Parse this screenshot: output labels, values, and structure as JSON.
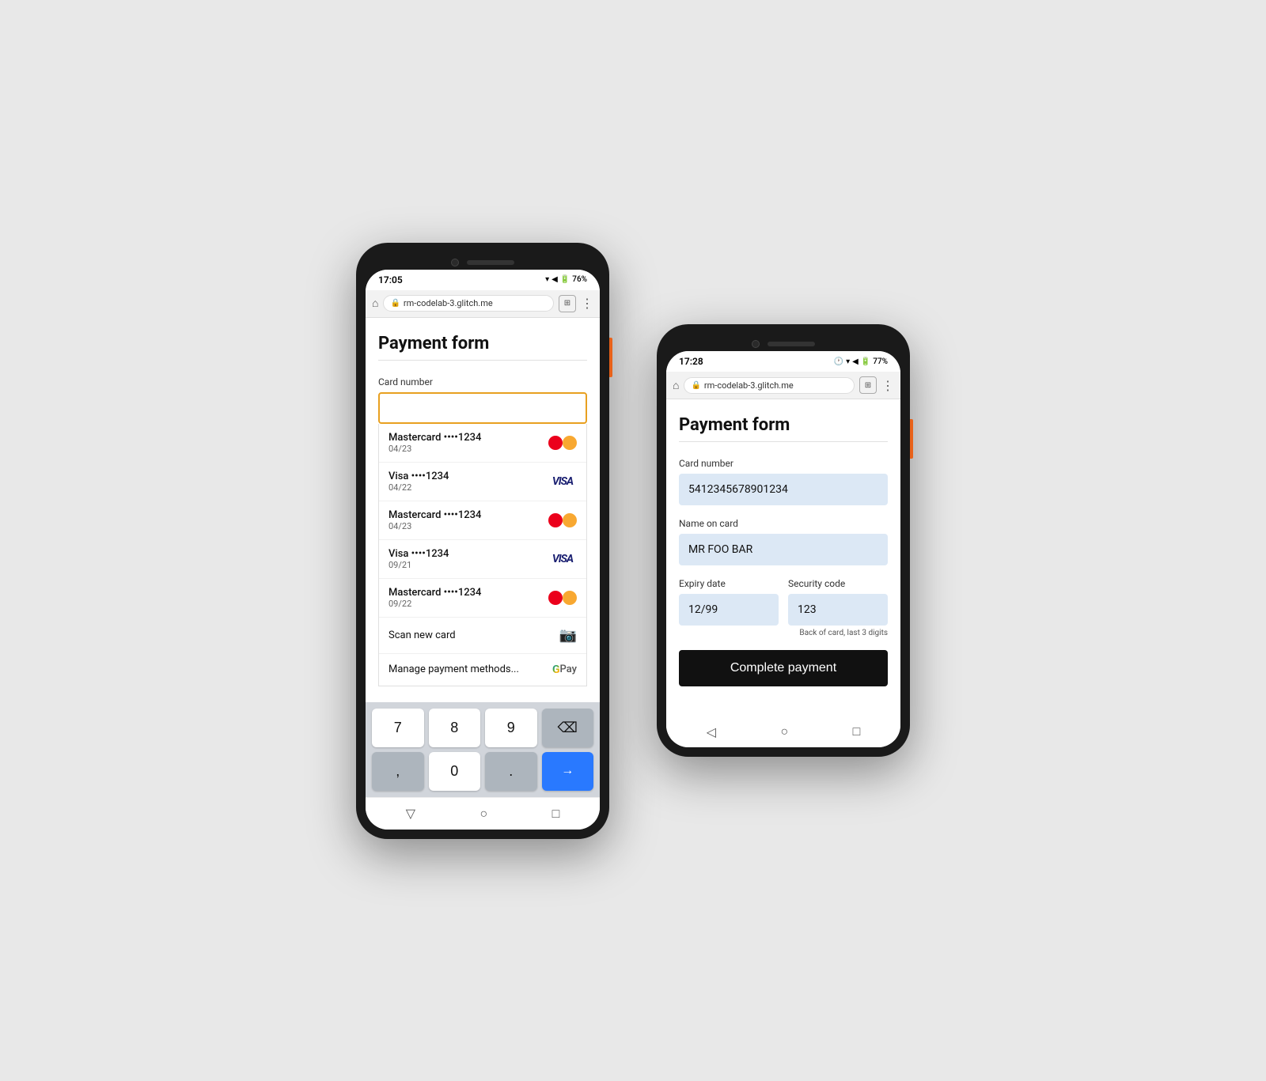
{
  "left_phone": {
    "status_bar": {
      "time": "17:05",
      "signal": "▼◀",
      "battery": "76%"
    },
    "browser": {
      "url": "rm-codelab-3.glitch.me"
    },
    "page": {
      "title": "Payment form",
      "card_number_label": "Card number",
      "card_input_placeholder": ""
    },
    "saved_cards": [
      {
        "name": "Mastercard ••••1234",
        "expiry": "04/23",
        "type": "mastercard"
      },
      {
        "name": "Visa ••••1234",
        "expiry": "04/22",
        "type": "visa"
      },
      {
        "name": "Mastercard ••••1234",
        "expiry": "04/23",
        "type": "mastercard"
      },
      {
        "name": "Visa ••••1234",
        "expiry": "09/21",
        "type": "visa"
      },
      {
        "name": "Mastercard ••••1234",
        "expiry": "09/22",
        "type": "mastercard"
      }
    ],
    "scan_card_label": "Scan new card",
    "manage_label": "Manage payment methods...",
    "keyboard": {
      "keys": [
        "7",
        "8",
        "9",
        "←",
        ",",
        "0",
        ".",
        "→"
      ]
    }
  },
  "right_phone": {
    "status_bar": {
      "time": "17:28",
      "battery": "77%"
    },
    "browser": {
      "url": "rm-codelab-3.glitch.me"
    },
    "page": {
      "title": "Payment form",
      "card_number_label": "Card number",
      "card_number_value": "5412345678901234",
      "name_label": "Name on card",
      "name_value": "MR FOO BAR",
      "expiry_label": "Expiry date",
      "expiry_value": "12/99",
      "security_label": "Security code",
      "security_value": "123",
      "security_hint": "Back of card, last 3 digits",
      "submit_label": "Complete payment"
    }
  }
}
